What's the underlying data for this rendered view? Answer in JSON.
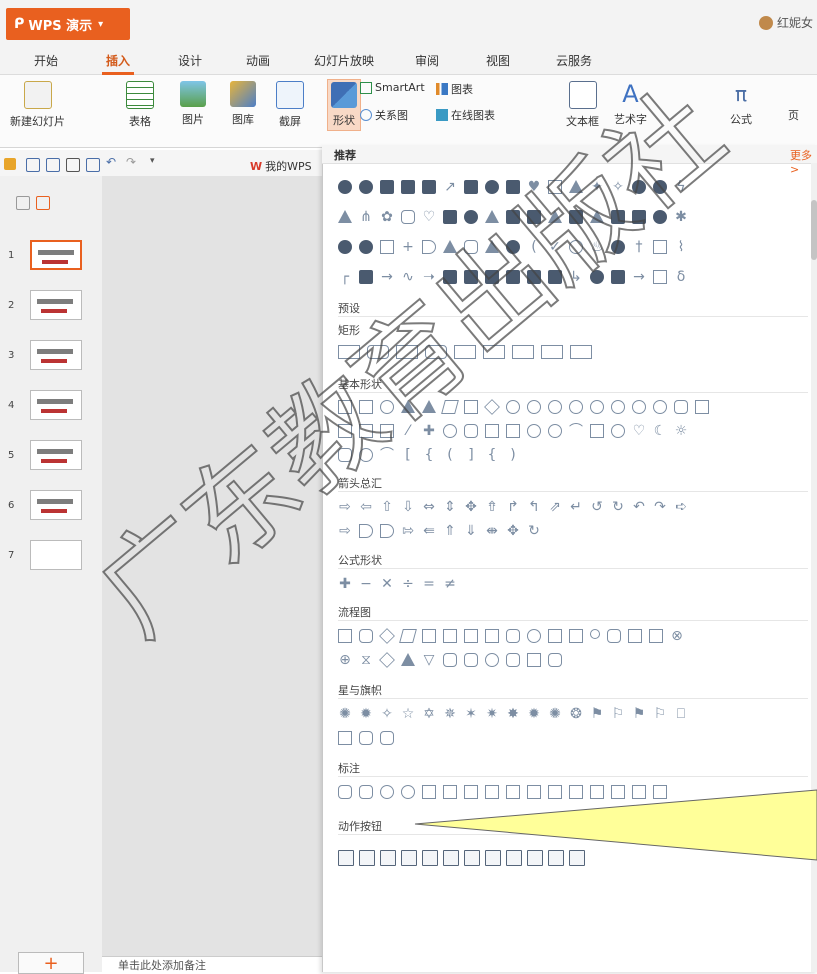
{
  "app": {
    "title": "WPS 演示",
    "logo_icon": "wps-logo-icon"
  },
  "user": {
    "name": "红妮女"
  },
  "tabs": [
    {
      "label": "开始"
    },
    {
      "label": "插入"
    },
    {
      "label": "设计"
    },
    {
      "label": "动画"
    },
    {
      "label": "幻灯片放映"
    },
    {
      "label": "审阅"
    },
    {
      "label": "视图"
    },
    {
      "label": "云服务"
    }
  ],
  "active_tab": "插入",
  "ribbon": {
    "new_slide": "新建幻灯片",
    "table": "表格",
    "picture": "图片",
    "gallery": "图库",
    "screenshot": "截屏",
    "shapes": "形状",
    "smartart": "SmartArt",
    "relation": "关系图",
    "chart": "图表",
    "online_chart": "在线图表",
    "textbox": "文本框",
    "wordart": "艺术字",
    "formula": "公式",
    "page": "页"
  },
  "qat": {
    "mywps": "我的WPS"
  },
  "slides": [
    {
      "num": "1"
    },
    {
      "num": "2"
    },
    {
      "num": "3"
    },
    {
      "num": "4"
    },
    {
      "num": "5"
    },
    {
      "num": "6"
    },
    {
      "num": "7"
    }
  ],
  "notes_placeholder": "单击此处添加备注",
  "shapes_panel": {
    "title": "推荐",
    "more": "更多>",
    "sections": {
      "preset": "预设",
      "rect": "矩形",
      "basic": "基本形状",
      "arrows": "箭头总汇",
      "formula": "公式形状",
      "flowchart": "流程图",
      "stars": "星与旗帜",
      "callouts": "标注",
      "action": "动作按钮"
    }
  },
  "watermark": {
    "line1": "广东教育出版社",
    "color": "#444444"
  },
  "colors": {
    "accent": "#e9601f",
    "callout": "#ffff99"
  }
}
